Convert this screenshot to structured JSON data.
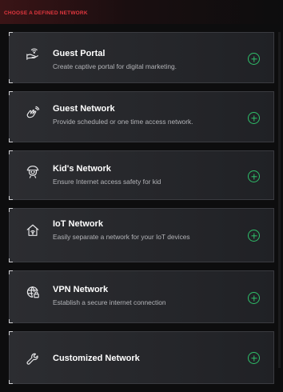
{
  "header": {
    "label": "CHOOSE A DEFINED NETWORK"
  },
  "networks": [
    {
      "icon": "hand-wifi-icon",
      "title": "Guest Portal",
      "description": "Create captive portal for digital marketing."
    },
    {
      "icon": "wave-user-icon",
      "title": "Guest Network",
      "description": "Provide scheduled or one time access network."
    },
    {
      "icon": "child-face-icon",
      "title": "Kid's Network",
      "description": "Ensure Internet access safety for kid"
    },
    {
      "icon": "smart-home-icon",
      "title": "IoT Network",
      "description": "Easily separate a network for your IoT devices"
    },
    {
      "icon": "globe-lock-icon",
      "title": "VPN Network",
      "description": "Establish a secure internet connection"
    },
    {
      "icon": "wrench-icon",
      "title": "Customized Network",
      "description": ""
    }
  ],
  "colors": {
    "accent_red": "#e3373f",
    "add_green": "#2fbf6a"
  }
}
